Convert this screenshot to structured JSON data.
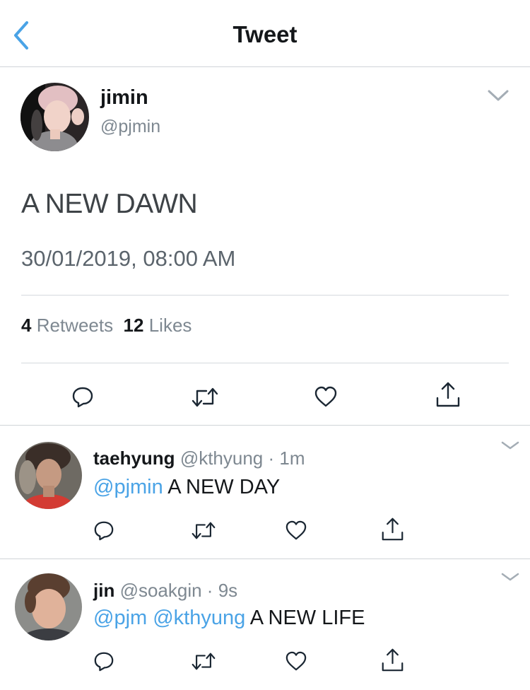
{
  "nav": {
    "title": "Tweet",
    "back_icon": "chevron-left-icon",
    "accent_color": "#4aa3e6"
  },
  "tweet": {
    "name": "jimin",
    "handle": "@pjmin",
    "text": "A NEW DAWN",
    "timestamp": "30/01/2019, 08:00 AM",
    "retweets_count": "4",
    "retweets_label": "Retweets",
    "likes_count": "12",
    "likes_label": "Likes",
    "actions": [
      "reply-icon",
      "retweet-icon",
      "like-icon",
      "share-icon"
    ]
  },
  "replies": [
    {
      "name": "taehyung",
      "meta": "@kthyung · 1m",
      "mentions": "@pjmin",
      "text": "A NEW DAY"
    },
    {
      "name": "jin",
      "meta": "@soakgin · 9s",
      "mentions": "@pjm @kthyung",
      "text": "A NEW LIFE"
    }
  ],
  "colors": {
    "mention": "#4aa3e6",
    "secondary_text": "#7e8891",
    "divider": "#cfd4d8"
  }
}
